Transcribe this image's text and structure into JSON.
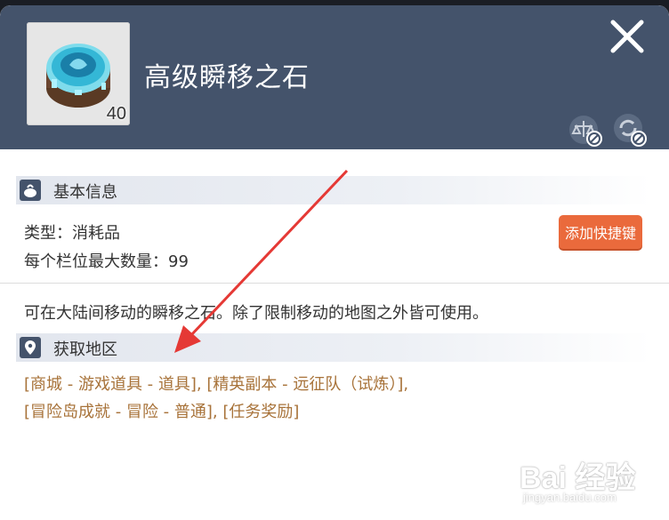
{
  "item": {
    "title": "高级瞬移之石",
    "count": "40",
    "icon": "teleport-stone-icon"
  },
  "header_icons": [
    "close-icon",
    "scale-disabled-icon",
    "recycle-disabled-icon"
  ],
  "basic_info": {
    "title": "基本信息",
    "icon": "bag-icon",
    "type_line": "类型：消耗品",
    "max_stack_line": "每个栏位最大数量：99",
    "hotkey_button": "添加快捷键"
  },
  "description": "可在大陆间移动的瞬移之石。除了限制移动的地图之外皆可使用。",
  "acquire": {
    "title": "获取地区",
    "icon": "location-pin-icon",
    "line1": [
      {
        "text": "[商城 - 游戏道具 - 道具]"
      },
      {
        "text": ", "
      },
      {
        "text": "[精英副本 - 远征队（试炼）]"
      },
      {
        "text": ","
      }
    ],
    "line2": [
      {
        "text": "[冒险岛成就 - 冒险 - 普通]"
      },
      {
        "text": ", "
      },
      {
        "text": "[任务奖励]"
      }
    ]
  },
  "watermark": {
    "text": "Bai 经验",
    "sub": "jingyan.baidu.com"
  },
  "colors": {
    "header_bg": "#44536b",
    "accent_button": "#ea6a3c",
    "source_text": "#a8733a",
    "annotation_arrow": "#e53935"
  }
}
